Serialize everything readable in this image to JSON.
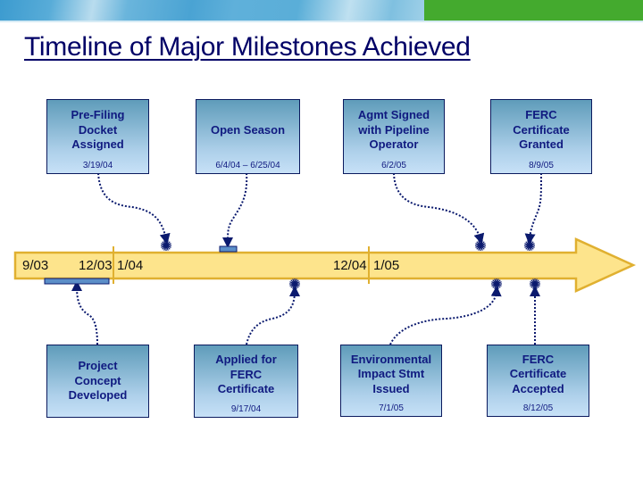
{
  "title": "Timeline of Major Milestones Achieved",
  "colors": {
    "header_blue": "#4aa3d3",
    "header_green": "#44aa2e",
    "title": "#000066",
    "arrow_fill": "#fde48c",
    "arrow_stroke": "#e0b030",
    "box_text": "#101a80",
    "connector": "#0b1a6e",
    "marker_bar": "#5b8ec8"
  },
  "timeline": {
    "axis_labels": [
      {
        "id": "sep03",
        "text": "9/03"
      },
      {
        "id": "dec03",
        "text": "12/03"
      },
      {
        "id": "jan04",
        "text": "1/04"
      },
      {
        "id": "dec04",
        "text": "12/04"
      },
      {
        "id": "jan05",
        "text": "1/05"
      }
    ],
    "year_dividers": [
      "2003/2004",
      "2004/2005"
    ]
  },
  "milestones_above": [
    {
      "label": "Pre-Filing Docket Assigned",
      "lines": [
        "Pre-Filing",
        "Docket",
        "Assigned"
      ],
      "date": "3/19/04",
      "marker": "star"
    },
    {
      "label": "Open Season",
      "lines": [
        "Open Season"
      ],
      "date": "6/4/04 – 6/25/04",
      "marker": "bar"
    },
    {
      "label": "Agmt Signed with Pipeline Operator",
      "lines": [
        "Agmt Signed",
        "with Pipeline",
        "Operator"
      ],
      "date": "6/2/05",
      "marker": "star"
    },
    {
      "label": "FERC Certificate Granted",
      "lines": [
        "FERC",
        "Certificate",
        "Granted"
      ],
      "date": "8/9/05",
      "marker": "star"
    }
  ],
  "milestones_below": [
    {
      "label": "Project Concept Developed",
      "lines": [
        "Project",
        "Concept",
        "Developed"
      ],
      "date": "",
      "marker": "bar"
    },
    {
      "label": "Applied for FERC Certificate",
      "lines": [
        "Applied for",
        "FERC",
        "Certificate"
      ],
      "date": "9/17/04",
      "marker": "star"
    },
    {
      "label": "Environmental Impact Stmt Issued",
      "lines": [
        "Environmental",
        "Impact Stmt",
        "Issued"
      ],
      "date": "7/1/05",
      "marker": "star"
    },
    {
      "label": "FERC Certificate Accepted",
      "lines": [
        "FERC",
        "Certificate",
        "Accepted"
      ],
      "date": "8/12/05",
      "marker": "star"
    }
  ]
}
